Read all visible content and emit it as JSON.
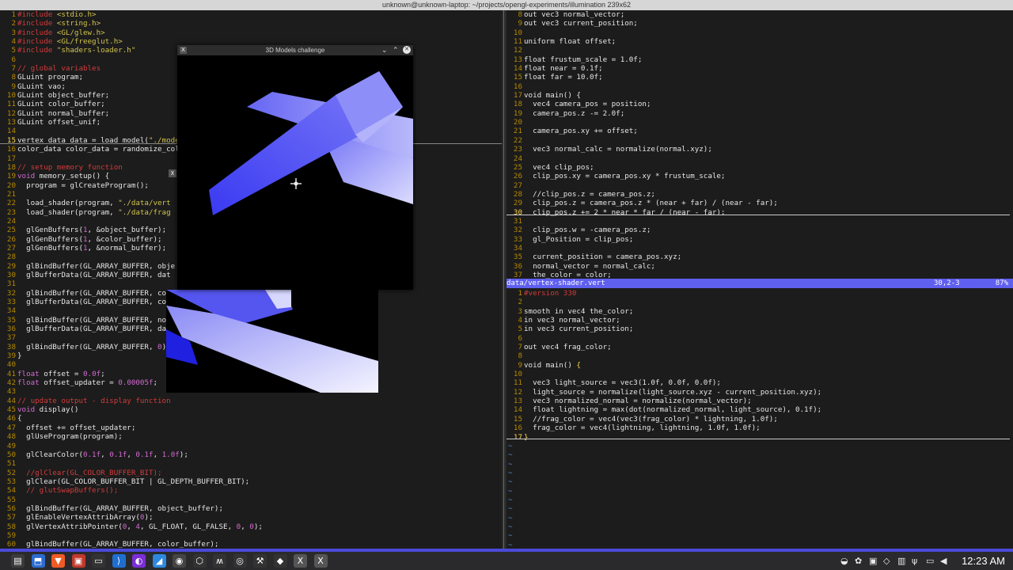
{
  "window_title": "unknown@unknown-laptop: ~/projects/opengl-experiments/illumination 239x62",
  "left_pane": {
    "lines": [
      {
        "n": "1",
        "t": [
          [
            "cm",
            "#include "
          ],
          [
            "str",
            "<stdio.h>"
          ]
        ]
      },
      {
        "n": "2",
        "t": [
          [
            "cm",
            "#include "
          ],
          [
            "str",
            "<string.h>"
          ]
        ]
      },
      {
        "n": "3",
        "t": [
          [
            "cm",
            "#include "
          ],
          [
            "str",
            "<GL/glew.h>"
          ]
        ]
      },
      {
        "n": "4",
        "t": [
          [
            "cm",
            "#include "
          ],
          [
            "str",
            "<GL/freeglut.h>"
          ]
        ]
      },
      {
        "n": "5",
        "t": [
          [
            "cm",
            "#include "
          ],
          [
            "str",
            "\"shaders-loader.h\""
          ]
        ]
      },
      {
        "n": "6",
        "t": []
      },
      {
        "n": "7",
        "t": [
          [
            "cm",
            "// global variables"
          ]
        ]
      },
      {
        "n": "8",
        "t": [
          [
            "",
            "GLuint program;"
          ]
        ]
      },
      {
        "n": "9",
        "t": [
          [
            "",
            "GLuint vao;"
          ]
        ]
      },
      {
        "n": "10",
        "t": [
          [
            "",
            "GLuint object_buffer;"
          ]
        ]
      },
      {
        "n": "11",
        "t": [
          [
            "",
            "GLuint color_buffer;"
          ]
        ]
      },
      {
        "n": "12",
        "t": [
          [
            "",
            "GLuint normal_buffer;"
          ]
        ]
      },
      {
        "n": "13",
        "t": [
          [
            "",
            "GLuint offset_unif;"
          ]
        ]
      },
      {
        "n": "14",
        "t": []
      },
      {
        "n": "15",
        "cur": true,
        "t": [
          [
            "",
            "vertex_data data = load_model("
          ],
          [
            "str",
            "\"./model"
          ]
        ]
      },
      {
        "n": "16",
        "t": [
          [
            "",
            "color_data color_data = randomize_colo"
          ]
        ]
      },
      {
        "n": "17",
        "t": []
      },
      {
        "n": "18",
        "t": [
          [
            "cm",
            "// setup memory function"
          ]
        ]
      },
      {
        "n": "19",
        "t": [
          [
            "kw",
            "void "
          ],
          [
            "",
            "memory_setup() {"
          ]
        ]
      },
      {
        "n": "20",
        "t": [
          [
            "",
            "  program = glCreateProgram();"
          ]
        ]
      },
      {
        "n": "21",
        "t": []
      },
      {
        "n": "22",
        "t": [
          [
            "",
            "  load_shader(program, "
          ],
          [
            "str",
            "\"./data/vert"
          ]
        ]
      },
      {
        "n": "23",
        "t": [
          [
            "",
            "  load_shader(program, "
          ],
          [
            "str",
            "\"./data/frag"
          ]
        ]
      },
      {
        "n": "24",
        "t": []
      },
      {
        "n": "25",
        "t": [
          [
            "",
            "  glGenBuffers("
          ],
          [
            "num",
            "1"
          ],
          [
            "",
            ", &object_buffer);"
          ]
        ]
      },
      {
        "n": "26",
        "t": [
          [
            "",
            "  glGenBuffers("
          ],
          [
            "num",
            "1"
          ],
          [
            "",
            ", &color_buffer);"
          ]
        ]
      },
      {
        "n": "27",
        "t": [
          [
            "",
            "  glGenBuffers("
          ],
          [
            "num",
            "1"
          ],
          [
            "",
            ", &normal_buffer);"
          ]
        ]
      },
      {
        "n": "28",
        "t": []
      },
      {
        "n": "29",
        "t": [
          [
            "",
            "  glBindBuffer(GL_ARRAY_BUFFER, obje"
          ]
        ]
      },
      {
        "n": "30",
        "t": [
          [
            "",
            "  glBufferData(GL_ARRAY_BUFFER, dat"
          ]
        ]
      },
      {
        "n": "31",
        "t": []
      },
      {
        "n": "32",
        "t": [
          [
            "",
            "  glBindBuffer(GL_ARRAY_BUFFER, colo"
          ]
        ]
      },
      {
        "n": "33",
        "t": [
          [
            "",
            "  glBufferData(GL_ARRAY_BUFFER, colo"
          ],
          [
            "",
            "                        _STATIC_DRAW);"
          ]
        ]
      },
      {
        "n": "34",
        "t": []
      },
      {
        "n": "35",
        "t": [
          [
            "",
            "  glBindBuffer(GL_ARRAY_BUFFER, nor"
          ]
        ]
      },
      {
        "n": "36",
        "t": [
          [
            "",
            "  glBufferData(GL_ARRAY_BUFFER, data"
          ],
          [
            "",
            "                        TIC_DRAW);"
          ]
        ]
      },
      {
        "n": "37",
        "t": []
      },
      {
        "n": "38",
        "t": [
          [
            "",
            "  glBindBuffer(GL_ARRAY_BUFFER, "
          ],
          [
            "num",
            "0"
          ],
          [
            "",
            ");"
          ]
        ]
      },
      {
        "n": "39",
        "t": [
          [
            "",
            "}"
          ]
        ]
      },
      {
        "n": "40",
        "t": []
      },
      {
        "n": "41",
        "t": [
          [
            "kw",
            "float "
          ],
          [
            "",
            "offset = "
          ],
          [
            "num",
            "0.0f"
          ],
          [
            "",
            ";"
          ]
        ]
      },
      {
        "n": "42",
        "t": [
          [
            "kw",
            "float "
          ],
          [
            "",
            "offset_updater = "
          ],
          [
            "num",
            "0.00005f"
          ],
          [
            "",
            ";"
          ]
        ]
      },
      {
        "n": "43",
        "t": []
      },
      {
        "n": "44",
        "t": [
          [
            "cm",
            "// update output - display function"
          ]
        ]
      },
      {
        "n": "45",
        "t": [
          [
            "kw",
            "void "
          ],
          [
            "",
            "display()"
          ]
        ]
      },
      {
        "n": "46",
        "t": [
          [
            "",
            "{"
          ]
        ]
      },
      {
        "n": "47",
        "t": [
          [
            "",
            "  offset += offset_updater;"
          ]
        ]
      },
      {
        "n": "48",
        "t": [
          [
            "",
            "  glUseProgram(program);"
          ]
        ]
      },
      {
        "n": "49",
        "t": []
      },
      {
        "n": "50",
        "t": [
          [
            "",
            "  glClearColor("
          ],
          [
            "num",
            "0.1f"
          ],
          [
            "",
            ", "
          ],
          [
            "num",
            "0.1f"
          ],
          [
            "",
            ", "
          ],
          [
            "num",
            "0.1f"
          ],
          [
            "",
            ", "
          ],
          [
            "num",
            "1.0f"
          ],
          [
            "",
            ");"
          ]
        ]
      },
      {
        "n": "51",
        "t": []
      },
      {
        "n": "52",
        "t": [
          [
            "cm",
            "  //glClear(GL_COLOR_BUFFER_BIT);"
          ]
        ]
      },
      {
        "n": "53",
        "t": [
          [
            "",
            "  glClear(GL_COLOR_BUFFER_BIT | GL_DEPTH_BUFFER_BIT);"
          ]
        ]
      },
      {
        "n": "54",
        "t": [
          [
            "cm",
            "  // glutSwapBuffers();"
          ]
        ]
      },
      {
        "n": "55",
        "t": []
      },
      {
        "n": "56",
        "t": [
          [
            "",
            "  glBindBuffer(GL_ARRAY_BUFFER, object_buffer);"
          ]
        ]
      },
      {
        "n": "57",
        "t": [
          [
            "",
            "  glEnableVertexAttribArray("
          ],
          [
            "num",
            "0"
          ],
          [
            "",
            ");"
          ]
        ]
      },
      {
        "n": "58",
        "t": [
          [
            "",
            "  glVertexAttribPointer("
          ],
          [
            "num",
            "0"
          ],
          [
            "",
            ", "
          ],
          [
            "num",
            "4"
          ],
          [
            "",
            ", GL_FLOAT, GL_FALSE, "
          ],
          [
            "num",
            "0"
          ],
          [
            "",
            ", "
          ],
          [
            "num",
            "0"
          ],
          [
            "",
            ");"
          ]
        ]
      },
      {
        "n": "59",
        "t": []
      },
      {
        "n": "60",
        "t": [
          [
            "",
            "  glBindBuffer(GL_ARRAY_BUFFER, color_buffer);"
          ]
        ]
      }
    ]
  },
  "right_top": {
    "lines": [
      {
        "n": "8",
        "t": [
          [
            "",
            "out vec3 normal_vector;"
          ]
        ]
      },
      {
        "n": "9",
        "t": [
          [
            "",
            "out vec3 current_position;"
          ]
        ]
      },
      {
        "n": "10",
        "t": []
      },
      {
        "n": "11",
        "t": [
          [
            "",
            "uniform float offset;"
          ]
        ]
      },
      {
        "n": "12",
        "t": []
      },
      {
        "n": "13",
        "t": [
          [
            "",
            "float frustum_scale = 1.0f;"
          ]
        ]
      },
      {
        "n": "14",
        "t": [
          [
            "",
            "float near = 0.1f;"
          ]
        ]
      },
      {
        "n": "15",
        "t": [
          [
            "",
            "float far = 10.0f;"
          ]
        ]
      },
      {
        "n": "16",
        "t": []
      },
      {
        "n": "17",
        "t": [
          [
            "",
            "void main() {"
          ]
        ]
      },
      {
        "n": "18",
        "t": [
          [
            "",
            "  vec4 camera_pos = position;"
          ]
        ]
      },
      {
        "n": "19",
        "t": [
          [
            "",
            "  camera_pos.z -= 2.0f;"
          ]
        ]
      },
      {
        "n": "20",
        "t": []
      },
      {
        "n": "21",
        "t": [
          [
            "",
            "  camera_pos.xy += offset;"
          ]
        ]
      },
      {
        "n": "22",
        "t": []
      },
      {
        "n": "23",
        "t": [
          [
            "",
            "  vec3 normal_calc = normalize(normal.xyz);"
          ]
        ]
      },
      {
        "n": "24",
        "t": []
      },
      {
        "n": "25",
        "t": [
          [
            "",
            "  vec4 clip_pos;"
          ]
        ]
      },
      {
        "n": "26",
        "t": [
          [
            "",
            "  clip_pos.xy = camera_pos.xy * frustum_scale;"
          ]
        ]
      },
      {
        "n": "27",
        "t": []
      },
      {
        "n": "28",
        "t": [
          [
            "",
            "  //clip_pos.z = camera_pos.z;"
          ]
        ]
      },
      {
        "n": "29",
        "t": [
          [
            "",
            "  clip_pos.z = camera_pos.z * (near + far) / (near - far);"
          ]
        ]
      },
      {
        "n": "30",
        "cur": true,
        "t": [
          [
            "",
            "  clip_pos.z += 2 * near * far / (near - far);"
          ]
        ]
      },
      {
        "n": "31",
        "t": []
      },
      {
        "n": "32",
        "t": [
          [
            "",
            "  clip_pos.w = -camera_pos.z;"
          ]
        ]
      },
      {
        "n": "33",
        "t": [
          [
            "",
            "  gl_Position = clip_pos;"
          ]
        ]
      },
      {
        "n": "34",
        "t": []
      },
      {
        "n": "35",
        "t": [
          [
            "",
            "  current_position = camera_pos.xyz;"
          ]
        ]
      },
      {
        "n": "36",
        "t": [
          [
            "",
            "  normal_vector = normal_calc;"
          ]
        ]
      },
      {
        "n": "37",
        "t": [
          [
            "",
            "  the_color = color;"
          ]
        ]
      }
    ]
  },
  "vertex_status": {
    "file": "data/vertex-shader.vert",
    "position": "30,2-3",
    "percent": "87%"
  },
  "right_bottom": {
    "lines": [
      {
        "n": "1",
        "t": [
          [
            "cm",
            "#version 330"
          ]
        ]
      },
      {
        "n": "2",
        "t": []
      },
      {
        "n": "3",
        "t": [
          [
            "",
            "smooth in vec4 the_color;"
          ]
        ]
      },
      {
        "n": "4",
        "t": [
          [
            "",
            "in vec3 normal_vector;"
          ]
        ]
      },
      {
        "n": "5",
        "t": [
          [
            "",
            "in vec3 current_position;"
          ]
        ]
      },
      {
        "n": "6",
        "t": []
      },
      {
        "n": "7",
        "t": [
          [
            "",
            "out vec4 frag_color;"
          ]
        ]
      },
      {
        "n": "8",
        "t": []
      },
      {
        "n": "9",
        "t": [
          [
            "",
            "void main() "
          ],
          [
            "cur",
            "{"
          ]
        ]
      },
      {
        "n": "10",
        "t": []
      },
      {
        "n": "11",
        "t": [
          [
            "",
            "  vec3 light_source = vec3(1.0f, 0.0f, 0.0f);"
          ]
        ]
      },
      {
        "n": "12",
        "t": [
          [
            "",
            "  light_source = normalize(light_source.xyz - current_position.xyz);"
          ]
        ]
      },
      {
        "n": "13",
        "t": [
          [
            "",
            "  vec3 normalized_normal = normalize(normal_vector);"
          ]
        ]
      },
      {
        "n": "14",
        "t": [
          [
            "",
            "  float lightning = max(dot(normalized_normal, light_source), 0.1f);"
          ]
        ]
      },
      {
        "n": "15",
        "t": [
          [
            "",
            "  //frag_color = vec4(vec3(frag_color) * lightning, 1.0f);"
          ]
        ]
      },
      {
        "n": "16",
        "t": [
          [
            "",
            "  frag_color = vec4(lightning, lightning, 1.0f, 1.0f);"
          ]
        ]
      },
      {
        "n": "17",
        "cur": true,
        "t": [
          [
            "cur",
            "}"
          ]
        ]
      }
    ],
    "tildes": 12
  },
  "gl_window": {
    "title": "3D Models challenge",
    "app_icon": "X",
    "minimize": "⌄",
    "maximize": "⌃",
    "close": "✕"
  },
  "small_window_icon": "X",
  "taskbar": {
    "clock": "12:23 AM",
    "apps": [
      {
        "name": "menu-icon",
        "glyph": "▤",
        "color": "#3b3b3b"
      },
      {
        "name": "files-icon",
        "glyph": "⬒",
        "color": "#2d6ccf"
      },
      {
        "name": "brave-icon",
        "glyph": "▼",
        "color": "#f05a24"
      },
      {
        "name": "terminal-red-icon",
        "glyph": "▣",
        "color": "#c0392b"
      },
      {
        "name": "terminal-icon",
        "glyph": "▭",
        "color": "#333"
      },
      {
        "name": "vscode-icon",
        "glyph": "⟩",
        "color": "#1f6fd1"
      },
      {
        "name": "purple-app-icon",
        "glyph": "◐",
        "color": "#7b2ed6"
      },
      {
        "name": "blue-app-icon",
        "glyph": "◢",
        "color": "#2d88e0"
      },
      {
        "name": "obs-icon",
        "glyph": "◉",
        "color": "#444"
      },
      {
        "name": "box-app-icon",
        "glyph": "⬡",
        "color": "#333"
      },
      {
        "name": "w-app-icon",
        "glyph": "ʍ",
        "color": "#333"
      },
      {
        "name": "chromium-icon",
        "glyph": "◎",
        "color": "#333"
      },
      {
        "name": "tools-icon",
        "glyph": "⚒",
        "color": "#333"
      },
      {
        "name": "blender-icon",
        "glyph": "◆",
        "color": "#333"
      },
      {
        "name": "x-app-icon-1",
        "glyph": "X",
        "color": "#555"
      },
      {
        "name": "x-app-icon-2",
        "glyph": "X",
        "color": "#555"
      }
    ],
    "tray": [
      {
        "name": "discord-icon",
        "glyph": "◒"
      },
      {
        "name": "colorful-app-icon",
        "glyph": "✿"
      },
      {
        "name": "recorder-icon",
        "glyph": "▣"
      },
      {
        "name": "network-icon",
        "glyph": "◇"
      },
      {
        "name": "security-icon",
        "glyph": "▥"
      },
      {
        "name": "usb-icon",
        "glyph": "ψ"
      },
      {
        "name": "battery-icon",
        "glyph": "▭"
      },
      {
        "name": "volume-icon",
        "glyph": "◀"
      }
    ]
  }
}
